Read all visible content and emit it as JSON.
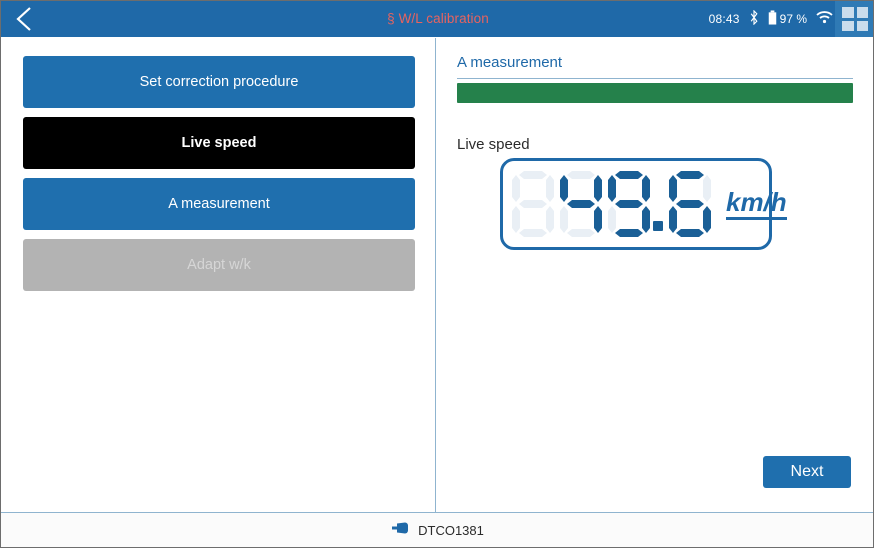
{
  "header": {
    "back_icon": "chevron-left-icon",
    "title": "§ W/L calibration",
    "time": "08:43",
    "bluetooth_icon": "bluetooth-icon",
    "battery_level": "97 %",
    "battery_icon": "battery-icon",
    "wifi_icon": "wifi-icon",
    "grid_icon": "apps-grid-icon"
  },
  "sidebar": {
    "items": [
      {
        "label": "Set correction procedure",
        "state": "blue"
      },
      {
        "label": "Live speed",
        "state": "active"
      },
      {
        "label": "A measurement",
        "state": "blue"
      },
      {
        "label": "Adapt w/k",
        "state": "disabled"
      }
    ]
  },
  "main": {
    "section_title": "A measurement",
    "progress_percent": 100,
    "live_speed_label": "Live speed",
    "lcd": {
      "value": "49.6",
      "digits": [
        "off",
        "4",
        "9",
        ".",
        "6"
      ],
      "unit": "km/h"
    },
    "next_label": "Next"
  },
  "footer": {
    "plug_icon": "plug-connector-icon",
    "device": "DTCO1381"
  },
  "colors": {
    "header_blue": "#1f69a8",
    "button_blue": "#1f6fae",
    "active_black": "#000000",
    "disabled_gray": "#b3b3b3",
    "progress_green": "#25814b",
    "title_red": "#e8635f",
    "lcd_blue": "#1a5f96",
    "lcd_off": "#e9eff5"
  }
}
